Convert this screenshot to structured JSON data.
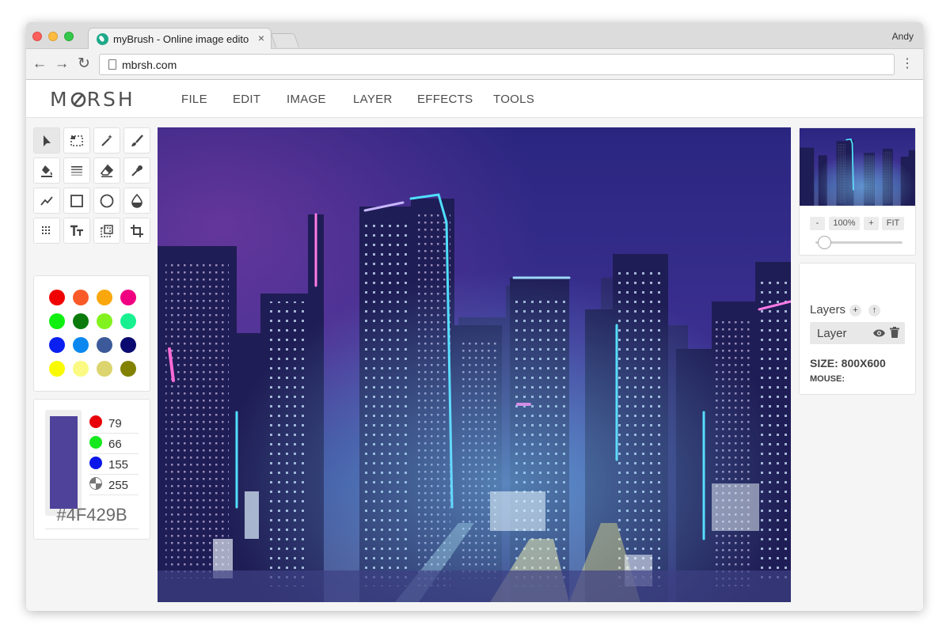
{
  "browser": {
    "tab_title": "myBrush - Online image editor",
    "tab_close": "×",
    "url": "mbrsh.com",
    "profile_name": "Andy",
    "back_glyph": "←",
    "forward_glyph": "→",
    "reload_glyph": "↻",
    "menu_glyph": "⋮"
  },
  "app": {
    "logo": "MBRSH",
    "menu": [
      "FILE",
      "EDIT",
      "IMAGE",
      "LAYER",
      "EFFECTS",
      "TOOLS"
    ]
  },
  "tools": [
    "select-arrow-icon",
    "marquee-select-icon",
    "magic-wand-icon",
    "brush-icon",
    "paint-bucket-icon",
    "gradient-icon",
    "eraser-icon",
    "eyedropper-icon",
    "line-icon",
    "rectangle-icon",
    "ellipse-icon",
    "blur-drop-icon",
    "pattern-icon",
    "text-icon",
    "clone-stamp-icon",
    "crop-icon"
  ],
  "swatches": [
    "#f00000",
    "#fa5a28",
    "#f9a70d",
    "#f00080",
    "#10f010",
    "#0a7a0a",
    "#82f21e",
    "#18f090",
    "#0a1ff0",
    "#0a88f0",
    "#3c5a9a",
    "#0a0a70",
    "#f9f900",
    "#fafa82",
    "#dcd46e",
    "#828200"
  ],
  "current_color": {
    "hex_value": "#4F429B",
    "display_hex": "#4F429B",
    "channels": [
      {
        "name": "red",
        "dot_color": "#e8000a",
        "value": "79"
      },
      {
        "name": "green",
        "dot_color": "#16e81e",
        "value": "66"
      },
      {
        "name": "blue",
        "dot_color": "#0a17e8",
        "value": "155"
      },
      {
        "name": "alpha",
        "dot_color": "#777777",
        "value": "255"
      }
    ]
  },
  "navigator": {
    "zoom_out": "-",
    "zoom_level": "100%",
    "zoom_in": "+",
    "fit": "FIT",
    "zoom_slider_fraction": 0.1
  },
  "layers": {
    "title": "Layers",
    "add": "+",
    "move_up": "↑",
    "items": [
      {
        "name": "Layer"
      }
    ],
    "size": "SIZE: 800X600",
    "mouse": "MOUSE:"
  }
}
